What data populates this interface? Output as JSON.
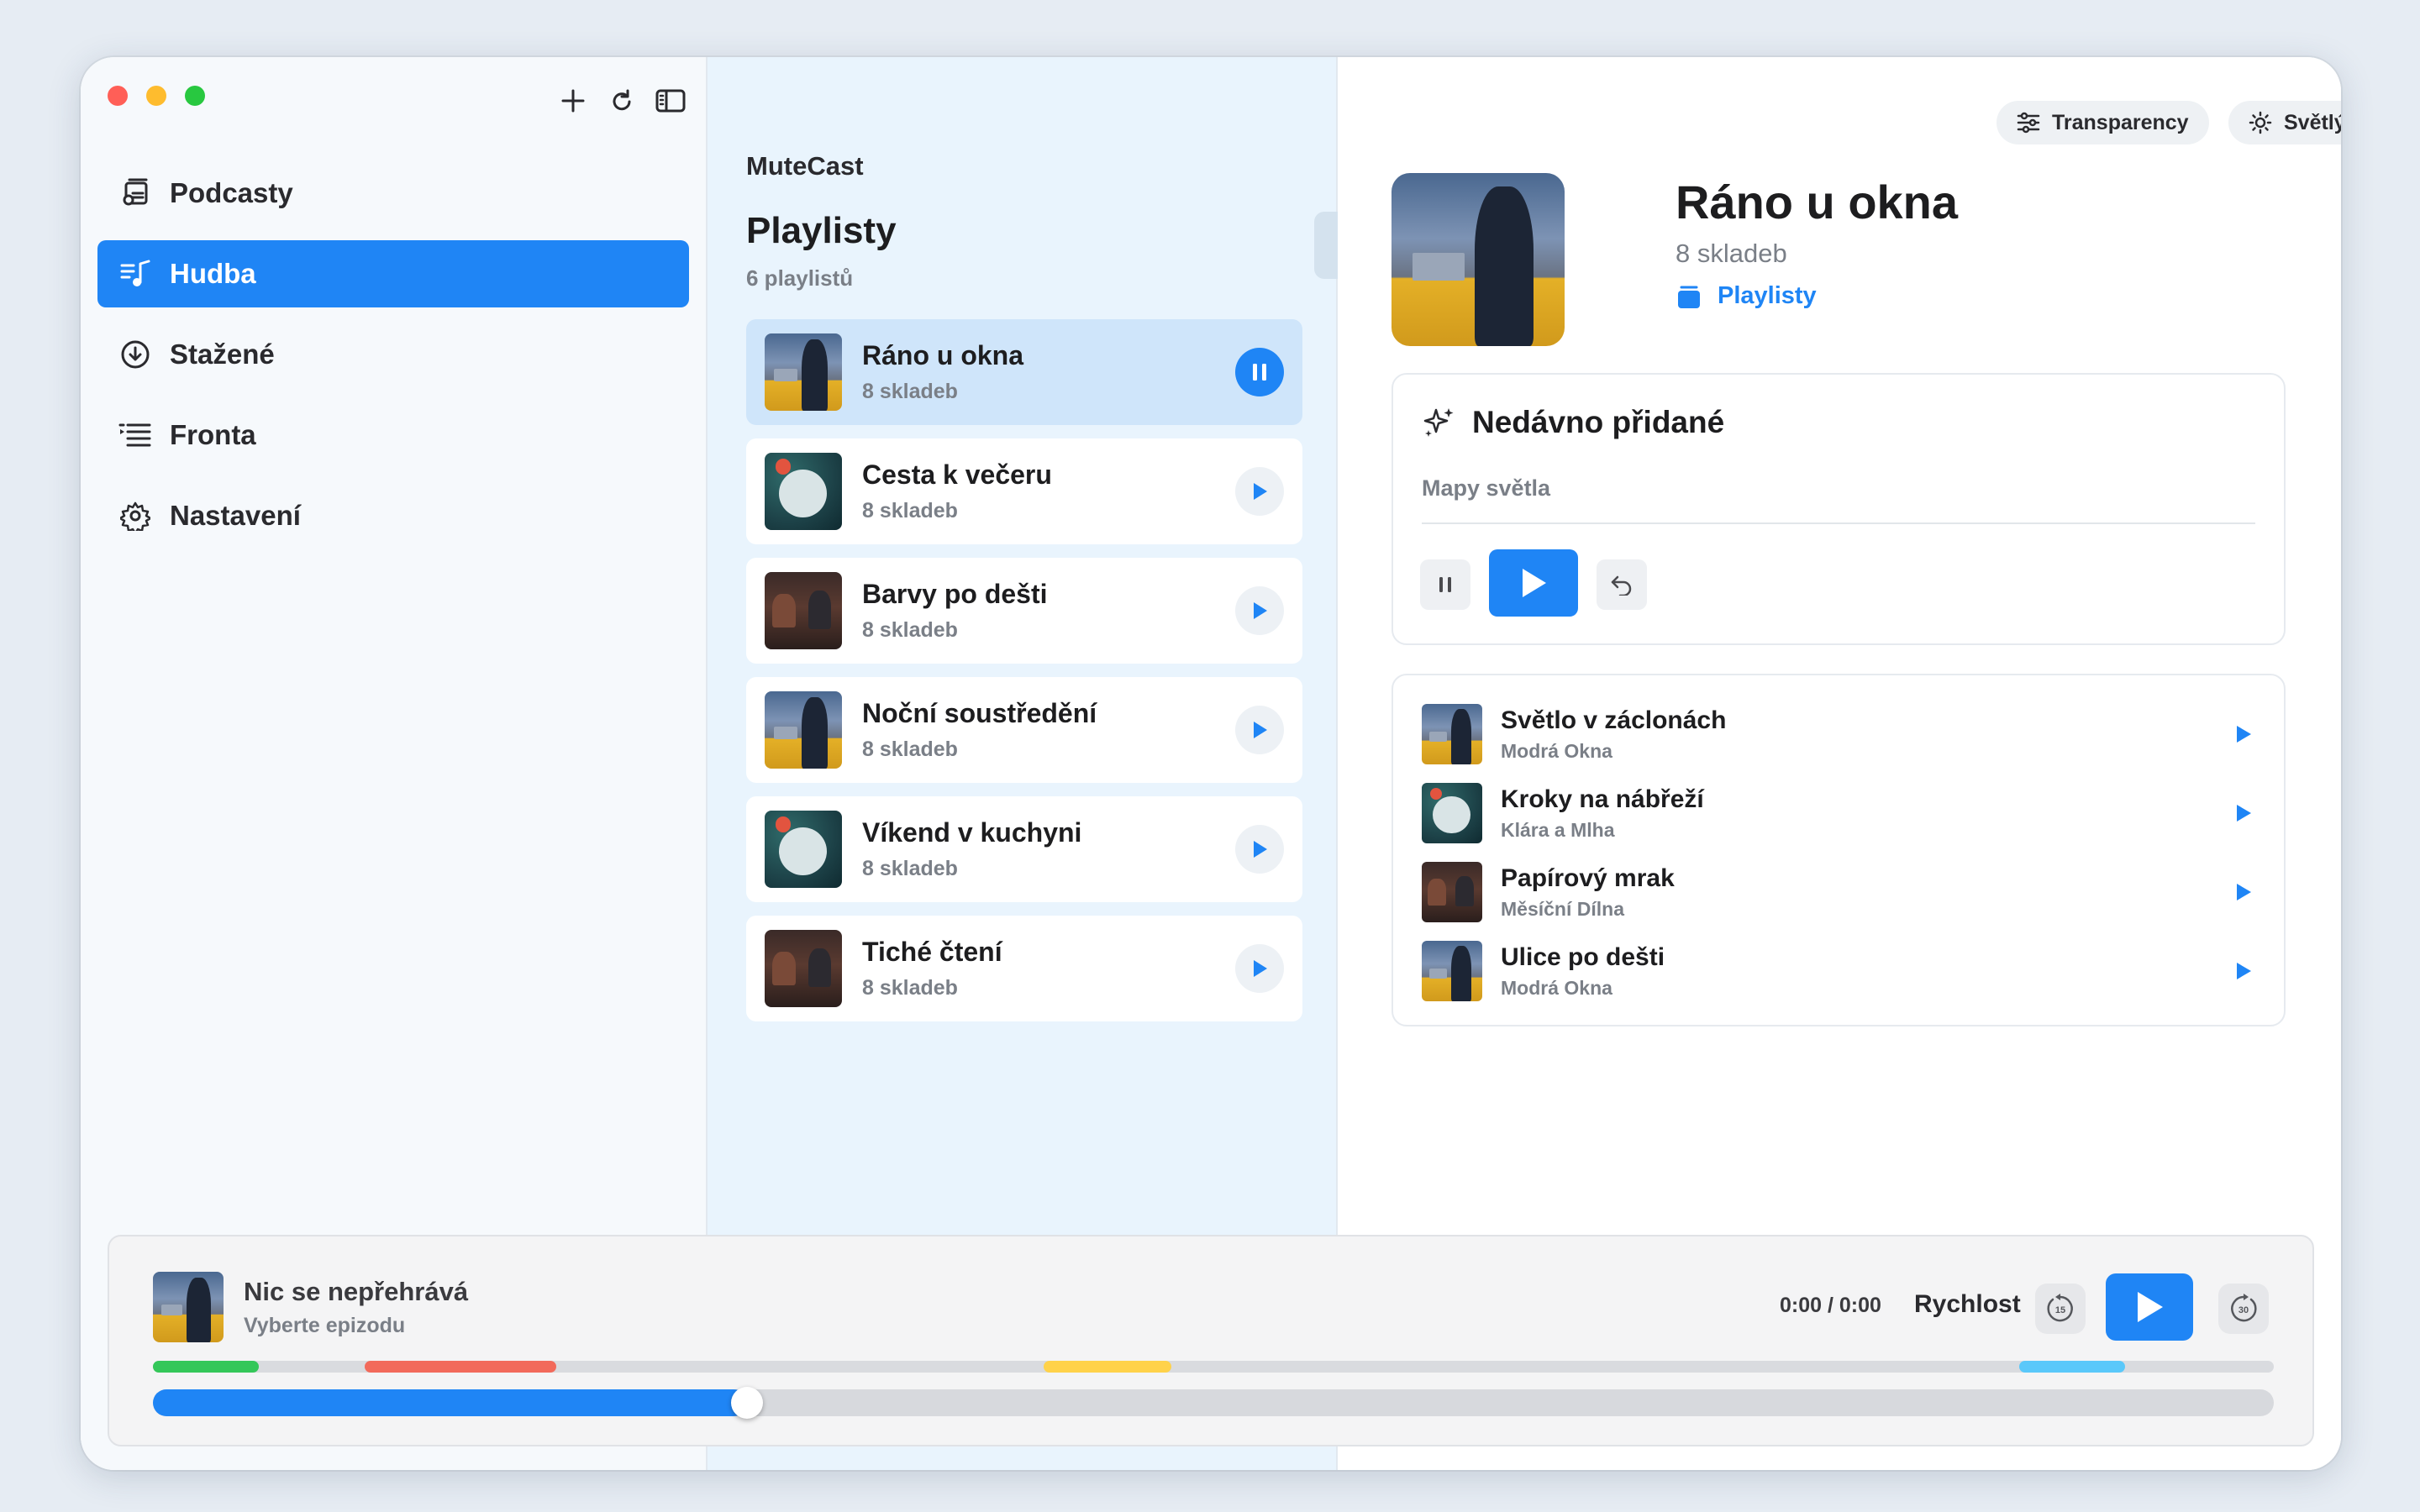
{
  "sidebar": {
    "items": [
      {
        "label": "Podcasty",
        "icon": "podcast-icon"
      },
      {
        "label": "Hudba",
        "icon": "music-icon",
        "active": true
      },
      {
        "label": "Stažené",
        "icon": "download-icon"
      },
      {
        "label": "Fronta",
        "icon": "queue-icon"
      },
      {
        "label": "Nastavení",
        "icon": "gear-icon"
      }
    ]
  },
  "middle": {
    "app_name": "MuteCast",
    "title": "Playlisty",
    "count": "6 playlistů",
    "playlists": [
      {
        "name": "Ráno u okna",
        "sub": "8 skladeb",
        "active": true,
        "thumb": "city"
      },
      {
        "name": "Cesta k večeru",
        "sub": "8 skladeb",
        "thumb": "globe"
      },
      {
        "name": "Barvy po dešti",
        "sub": "8 skladeb",
        "thumb": "cafe"
      },
      {
        "name": "Noční soustředění",
        "sub": "8 skladeb",
        "thumb": "city"
      },
      {
        "name": "Víkend v kuchyni",
        "sub": "8 skladeb",
        "thumb": "globe"
      },
      {
        "name": "Tiché čtení",
        "sub": "8 skladeb",
        "thumb": "cafe"
      }
    ]
  },
  "detail": {
    "transparency_label": "Transparency",
    "theme_label": "Světlý",
    "title": "Ráno u okna",
    "subtitle": "8 skladeb",
    "link_label": "Playlisty",
    "recent": {
      "heading": "Nedávno přidané",
      "subtitle": "Mapy světla"
    },
    "tracks": [
      {
        "name": "Světlo v záclonách",
        "artist": "Modrá Okna",
        "thumb": "city"
      },
      {
        "name": "Kroky na nábřeží",
        "artist": "Klára a Mlha",
        "thumb": "globe"
      },
      {
        "name": "Papírový mrak",
        "artist": "Měsíční Dílna",
        "thumb": "cafe"
      },
      {
        "name": "Ulice po dešti",
        "artist": "Modrá Okna",
        "thumb": "city"
      }
    ]
  },
  "player": {
    "title": "Nic se nepřehrává",
    "subtitle": "Vyberte epizodu",
    "time": "0:00 / 0:00",
    "speed_label": "Rychlost",
    "skip_back": "15",
    "skip_fwd": "30",
    "progress_fraction": 0.28,
    "chapters": [
      {
        "start": 0.0,
        "end": 0.05,
        "color": "#34c759"
      },
      {
        "start": 0.1,
        "end": 0.19,
        "color": "#f26a5b"
      },
      {
        "start": 0.42,
        "end": 0.48,
        "color": "#ffd24a"
      },
      {
        "start": 0.88,
        "end": 0.93,
        "color": "#5ac8fa"
      }
    ]
  },
  "colors": {
    "accent": "#1f85f5",
    "close": "#ff5f57",
    "minimize": "#febc2e",
    "zoom": "#28c840"
  }
}
